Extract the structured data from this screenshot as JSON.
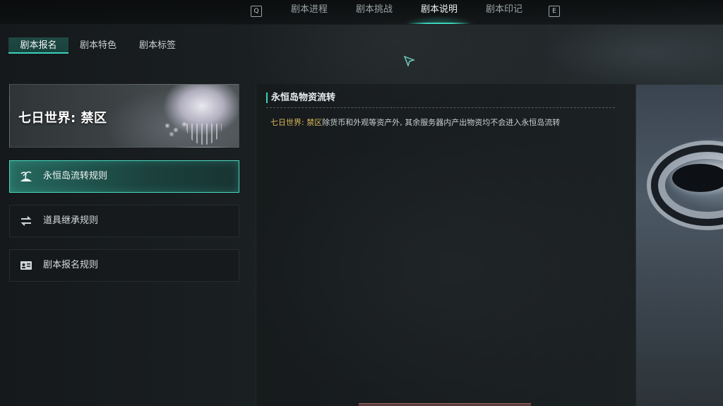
{
  "top_nav": {
    "left_key": "Q",
    "right_key": "E",
    "tabs": [
      {
        "label": "剧本进程"
      },
      {
        "label": "剧本挑战"
      },
      {
        "label": "剧本说明"
      },
      {
        "label": "剧本印记"
      }
    ],
    "active_tab": "剧本说明"
  },
  "sub_tabs": {
    "items": [
      {
        "label": "剧本报名"
      },
      {
        "label": "剧本特色"
      },
      {
        "label": "剧本标签"
      }
    ],
    "active": "剧本报名"
  },
  "banner": {
    "title": "七日世界: 禁区"
  },
  "rules": {
    "items": [
      {
        "label": "永恒岛流转规则",
        "icon": "island-icon"
      },
      {
        "label": "道具继承规则",
        "icon": "swap-arrows-icon"
      },
      {
        "label": "剧本报名规则",
        "icon": "id-card-icon"
      }
    ],
    "active": "永恒岛流转规则"
  },
  "content": {
    "title": "永恒岛物资流转",
    "highlight": "七日世界: 禁区",
    "body": "除货币和外观等资产外, 其余服务器内产出物资均不会进入永恒岛流转"
  },
  "colors": {
    "accent": "#3bd2b9",
    "highlight_text": "#d9b65a",
    "background": "#111416"
  }
}
